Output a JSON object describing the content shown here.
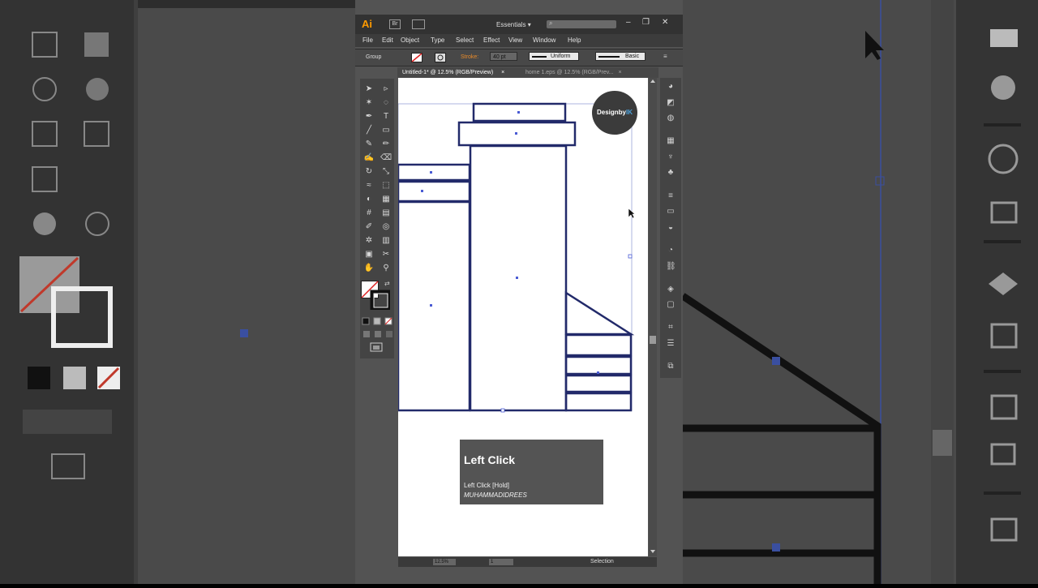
{
  "app": {
    "logo": "Ai",
    "bridge_label": "Br",
    "workspace": "Essentials",
    "workspace_arrow": "▾",
    "window_controls": [
      "–",
      "❐",
      "✕"
    ]
  },
  "menu": [
    "File",
    "Edit",
    "Object",
    "Type",
    "Select",
    "Effect",
    "View",
    "Window",
    "Help"
  ],
  "control_bar": {
    "selection_type": "Group",
    "stroke_label": "Stroke:",
    "stroke_value": "40 pt",
    "profile_label": "Uniform",
    "brush_label": "Basic"
  },
  "tabs": [
    {
      "label": "Untitled-1* @ 12.5% (RGB/Preview)",
      "close": "×"
    },
    {
      "label": "home 1.eps @ 12.5% (RGB/Prev...",
      "close": "×"
    }
  ],
  "canvas": {
    "logo_text_main": "Designby",
    "logo_text_accent": "IK"
  },
  "click_panel": {
    "title": "Left Click",
    "subtitle": "Left Click [Hold]",
    "user": "MUHAMMADIDREES"
  },
  "status": {
    "zoom": "12.5%",
    "page": "1",
    "tool": "Selection"
  },
  "icons": {
    "tools": [
      "selection-icon",
      "direct-selection-icon",
      "magic-wand-icon",
      "lasso-icon",
      "pen-icon",
      "type-icon",
      "line-icon",
      "rectangle-icon",
      "paintbrush-icon",
      "pencil-icon",
      "blob-brush-icon",
      "eraser-icon",
      "rotate-icon",
      "scale-icon",
      "warp-icon",
      "free-transform-icon",
      "shape-builder-icon",
      "perspective-grid-icon",
      "mesh-icon",
      "gradient-icon",
      "eyedropper-icon",
      "blend-icon",
      "symbol-sprayer-icon",
      "column-graph-icon",
      "artboard-icon",
      "slice-icon",
      "hand-icon",
      "zoom-icon"
    ],
    "panels": [
      "color-icon",
      "color-guide-icon",
      "appearance-icon",
      "swatches-icon",
      "brushes-icon",
      "symbols-icon",
      "stroke-icon",
      "gradient-icon",
      "transparency-icon",
      "graphic-styles-icon",
      "links-icon",
      "layers-icon",
      "artboards-icon",
      "transform-icon",
      "align-icon",
      "pathfinder-icon"
    ]
  },
  "colors": {
    "accent_orange": "#ff9a00",
    "stroke_label": "#e98b2a",
    "selection_blue": "#4a5bd4",
    "logo_accent": "#4aa3df"
  }
}
